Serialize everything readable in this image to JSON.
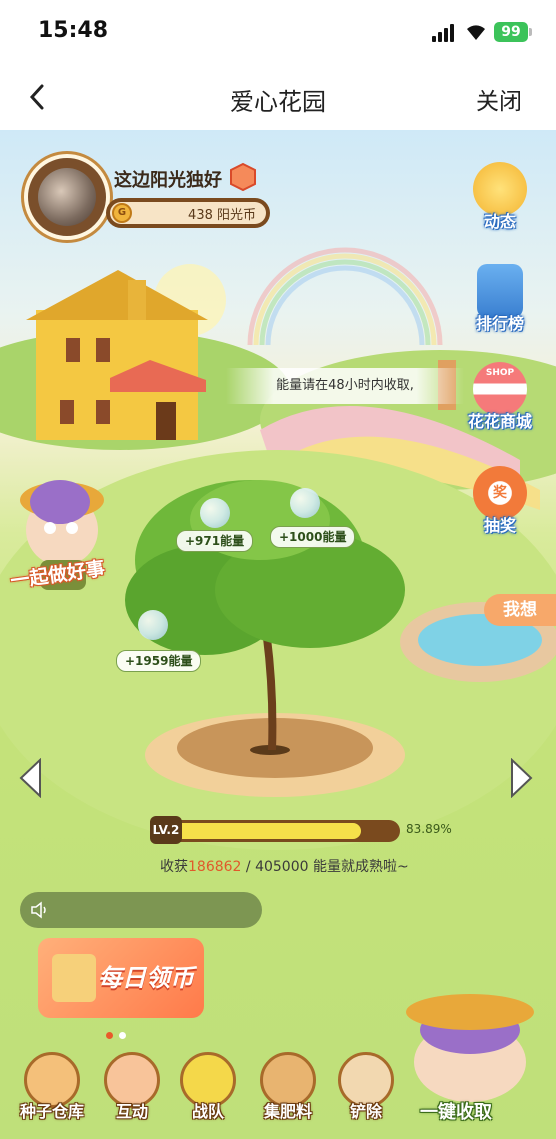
{
  "status_bar": {
    "time": "15:48",
    "battery": "99"
  },
  "nav": {
    "title": "爱心花园",
    "close": "关闭"
  },
  "profile": {
    "name": "这边阳光独好",
    "coins": "438 阳光币"
  },
  "side_buttons": [
    "动态",
    "排行榜",
    "花花商城",
    "抽奖",
    "我想"
  ],
  "side_icon_text": {
    "shop": "SHOP",
    "lottery": "奖"
  },
  "left_badge": "一起做好事",
  "notice": "能量请在48小时内收取,",
  "energy_tags": [
    "+971能量",
    "+1000能量",
    "+1959能量"
  ],
  "level": {
    "label": "LV.2",
    "progress_text": "83.89%",
    "progress": 0.8389
  },
  "harvest": {
    "prefix": "收获",
    "current": "186862",
    "suffix": " / 405000 能量就成熟啦~"
  },
  "banner": {
    "text": "每日领币"
  },
  "bottom_buttons": [
    "种子仓库",
    "互动",
    "战队",
    "集肥料",
    "铲除",
    "一键收取"
  ],
  "colors": {
    "accent": "#7a4a1e",
    "progress": "#f6e04a",
    "highlight": "#e05a2b"
  }
}
